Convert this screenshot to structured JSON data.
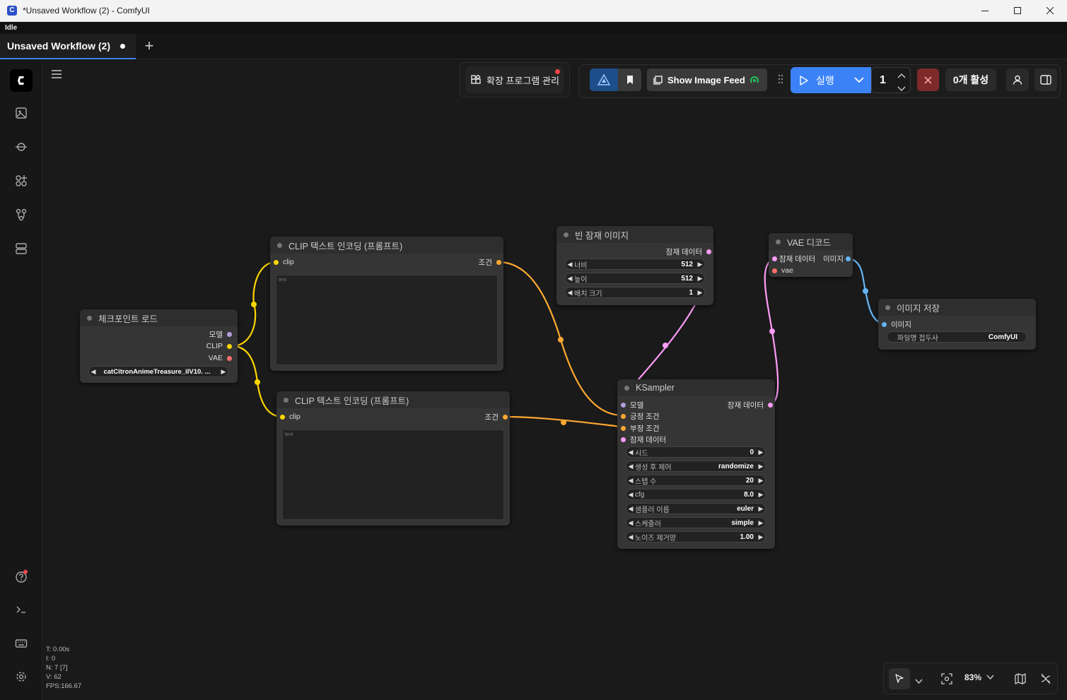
{
  "window": {
    "title": "*Unsaved Workflow (2) - ComfyUI",
    "status": "Idle",
    "app_icon": "comfy-icon"
  },
  "tabs": [
    {
      "label": "Unsaved Workflow (2)"
    }
  ],
  "toolbar": {
    "extensions_label": "확장 프로그램 관리",
    "image_feed_label": "Show Image Feed",
    "run_label": "실행",
    "batch_count": "1",
    "active_label": "0개 활성"
  },
  "nodes": {
    "checkpoint": {
      "title": "체크포인트 로드",
      "out_model": "모델",
      "out_clip": "CLIP",
      "out_vae": "VAE",
      "ckpt_name": "catCitronAnimeTreasure_ilV10. ..."
    },
    "clip1": {
      "title": "CLIP 텍스트 인코딩 (프롬프트)",
      "in_clip": "clip",
      "out_cond": "조건",
      "placeholder": "text"
    },
    "clip2": {
      "title": "CLIP 텍스트 인코딩 (프롬프트)",
      "in_clip": "clip",
      "out_cond": "조건",
      "placeholder": "text"
    },
    "empty_latent": {
      "title": "빈 잠재 이미지",
      "out_latent": "잠재 데이터",
      "width_label": "너비",
      "width": "512",
      "height_label": "높이",
      "height": "512",
      "batch_label": "배치 크기",
      "batch": "1"
    },
    "ksampler": {
      "title": "KSampler",
      "in_model": "모델",
      "in_pos": "긍정 조건",
      "in_neg": "부정 조건",
      "in_latent": "잠재 데이터",
      "out_latent": "잠재 데이터",
      "widgets": [
        {
          "label": "시드",
          "value": "0"
        },
        {
          "label": "생성 후 제어",
          "value": "randomize"
        },
        {
          "label": "스텝 수",
          "value": "20"
        },
        {
          "label": "cfg",
          "value": "8.0"
        },
        {
          "label": "샘플러 이름",
          "value": "euler"
        },
        {
          "label": "스케줄러",
          "value": "simple"
        },
        {
          "label": "노이즈 제거양",
          "value": "1.00"
        }
      ]
    },
    "vae_decode": {
      "title": "VAE 디코드",
      "in_samples": "잠재 데이터",
      "in_vae": "vae",
      "out_image": "이미지"
    },
    "save_image": {
      "title": "이미지 저장",
      "in_images": "이미지",
      "prefix_label": "파일명 접두사",
      "prefix": "ComfyUI"
    }
  },
  "stats": {
    "t": "T: 0.00s",
    "i": "I: 0",
    "n": "N: 7 [7]",
    "v": "V: 62",
    "fps": "FPS:166.67"
  },
  "zoom": {
    "level": "83%"
  },
  "colors": {
    "clip": "#ffd500",
    "conditioning": "#ffa931",
    "latent": "#ff9cf9",
    "image": "#64b5f6",
    "vae": "#ff6e6e",
    "model": "#b39ddb",
    "accent": "#3b82f6"
  }
}
